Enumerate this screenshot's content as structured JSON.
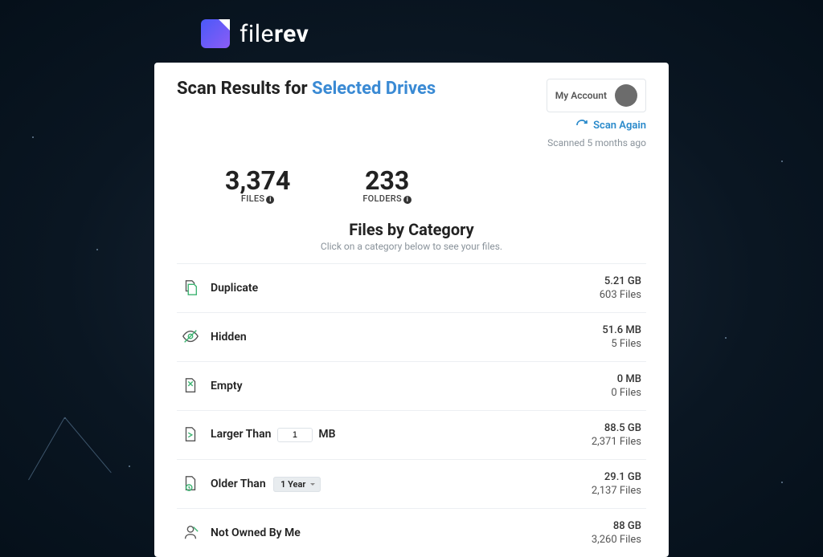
{
  "brand": {
    "name_a": "file",
    "name_b": "rev"
  },
  "header": {
    "title_prefix": "Scan Results for ",
    "title_link": "Selected Drives",
    "account_label": "My Account",
    "scan_again": "Scan Again",
    "scanned_ago": "Scanned 5 months ago"
  },
  "stats": {
    "files_count": "3,374",
    "files_label": "FILES",
    "folders_count": "233",
    "folders_label": "FOLDERS"
  },
  "section": {
    "title": "Files by Category",
    "subtitle": "Click on a category below to see your files."
  },
  "larger_than": {
    "value": "1",
    "unit": "MB"
  },
  "older_than": {
    "value": "1 Year"
  },
  "categories": [
    {
      "icon": "duplicate-icon",
      "name": "Duplicate",
      "size": "5.21 GB",
      "files": "603 Files"
    },
    {
      "icon": "hidden-icon",
      "name": "Hidden",
      "size": "51.6 MB",
      "files": "5 Files"
    },
    {
      "icon": "empty-icon",
      "name": "Empty",
      "size": "0 MB",
      "files": "0 Files"
    },
    {
      "icon": "larger-icon",
      "name": "Larger Than",
      "size": "88.5 GB",
      "files": "2,371 Files",
      "input": "size"
    },
    {
      "icon": "older-icon",
      "name": "Older Than",
      "size": "29.1 GB",
      "files": "2,137 Files",
      "input": "age"
    },
    {
      "icon": "owner-icon",
      "name": "Not Owned By Me",
      "size": "88 GB",
      "files": "3,260 Files"
    }
  ]
}
